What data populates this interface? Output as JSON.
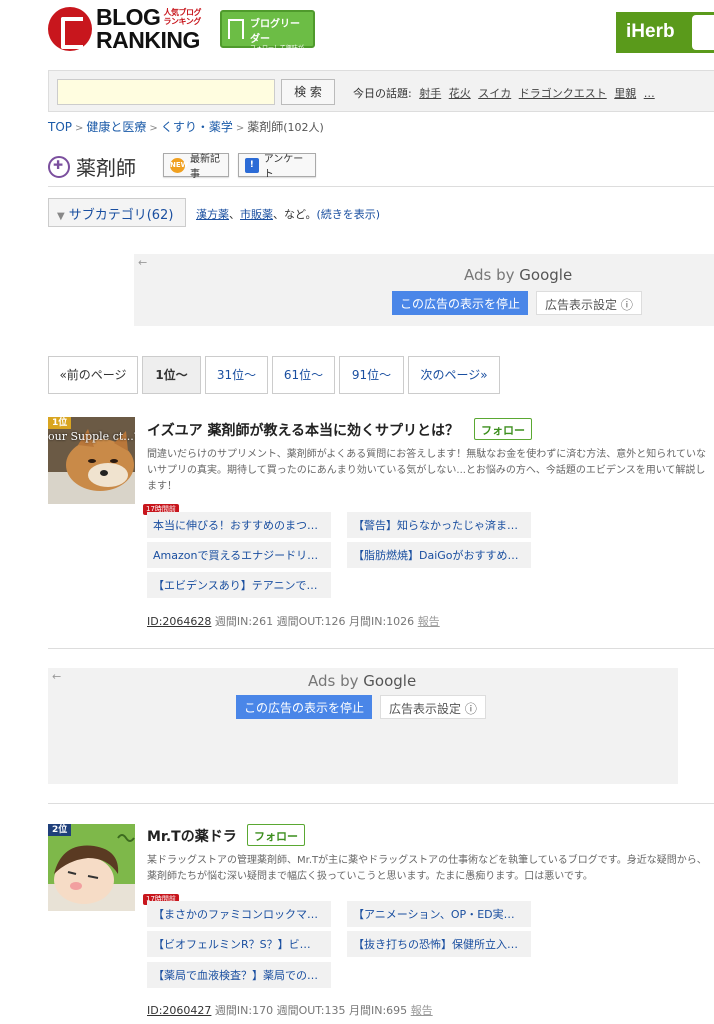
{
  "header": {
    "logo_line1": "BLOG",
    "logo_small": "人気ブログ ランキング",
    "logo_line2": "RANKING",
    "reader_title": "ブログリーダー",
    "reader_sub": "フォローして興味がある ブログをチェックしよう!",
    "iherb": "iHerb"
  },
  "search": {
    "button": "検 索",
    "topics_label": "今日の話題:",
    "topics": [
      "射手",
      "花火",
      "スイカ",
      "ドラゴンクエスト",
      "里親",
      "…"
    ]
  },
  "breadcrumb": {
    "items": [
      "TOP",
      "健康と医療",
      "くすり・薬学"
    ],
    "current": "薬剤師",
    "count": "(102人)",
    "separator": ">"
  },
  "category": {
    "name": "薬剤師",
    "latest_btn": "最新記事",
    "latest_icon": "NEW",
    "survey_btn": "アンケート",
    "survey_icon": "!"
  },
  "subcategory": {
    "button": "サブカテゴリ(62)",
    "items": [
      "漢方薬",
      "市販薬"
    ],
    "comma": "、",
    "suffix": "、など。",
    "more": "(続きを表示)"
  },
  "ads": {
    "by": "Ads by",
    "google": "Google",
    "stop": "この広告の表示を停止",
    "settings": "広告表示設定 ⓘ",
    "back": "←"
  },
  "pager": {
    "prev": "«前のページ",
    "pages": [
      "1位〜",
      "31位〜",
      "61位〜",
      "91位〜"
    ],
    "next": "次のページ»"
  },
  "entries": [
    {
      "rank": "1位",
      "thumb_text": "our Supple ct...?",
      "title": "イズユア 薬剤師が教える本当に効くサプリとは？",
      "follow": "フォロー",
      "desc": "間違いだらけのサプリメント、薬剤師がよくある質問にお答えします！無駄なお金を使わずに済む方法、意外と知られていないサプリの真実。期待して買ったのにあんまり効いている気がしない...とお悩みの方へ、今話題のエビデンスを用いて解説します！",
      "new_label": "17時間前",
      "articles": [
        "本当に伸びる！おすすめのまつ…",
        "【警告】知らなかったじゃ済ま…",
        "Amazonで買えるエナジードリ…",
        "【脂肪燃焼】DaiGoがおすすめ…",
        "【エビデンスあり】テアニンで…"
      ],
      "id": "ID:2064628",
      "stats": " 週間IN:261 週間OUT:126 月間IN:1026 ",
      "report": "報告"
    },
    {
      "rank": "2位",
      "title": "Mr.Tの薬ドラ",
      "follow": "フォロー",
      "desc": "某ドラッグストアの管理薬剤師、Mr.Tが主に薬やドラッグストアの仕事術などを執筆しているブログです。身近な疑問から、薬剤師たちが悩む深い疑問まで幅広く扱っていこうと思います。たまに愚痴ります。口は悪いです。",
      "new_label": "17時間前",
      "articles": [
        "【まさかのファミコンロックマ…",
        "【アニメーション、OP・ED実…",
        "【ビオフェルミンR？S？】ビ…",
        "【抜き打ちの恐怖】保健所立入…",
        "【薬局で血液検査？】薬局での…"
      ],
      "id": "ID:2060427",
      "stats": " 週間IN:170 週間OUT:135 月間IN:695 ",
      "report": "報告"
    }
  ],
  "colors": {
    "brand_red": "#c8161d",
    "reader_green": "#6cbd45",
    "iherb_green": "#5a9a1b",
    "link_blue": "#1a4fa0",
    "ad_button_blue": "#4a86e8"
  }
}
